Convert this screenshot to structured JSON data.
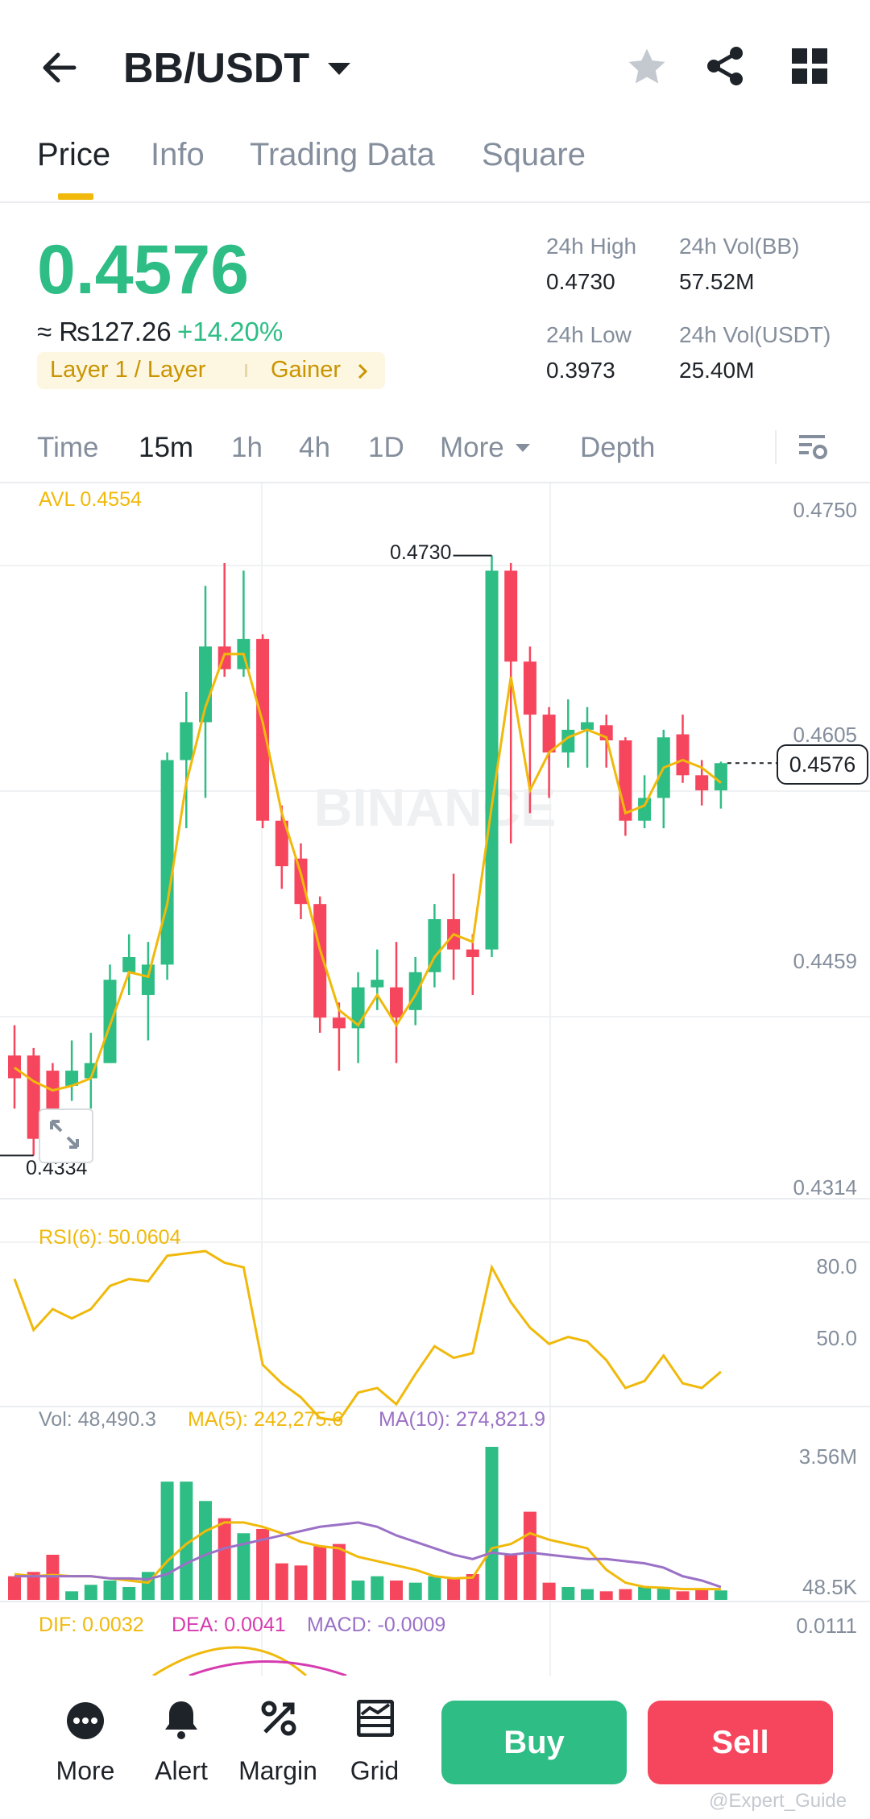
{
  "header": {
    "pair": "BB/USDT",
    "back_icon": "arrow-left-icon",
    "favorite_icon": "star-icon",
    "share_icon": "share-icon",
    "grid_icon": "grid-icon"
  },
  "tabs": [
    {
      "label": "Price",
      "active": true
    },
    {
      "label": "Info",
      "active": false
    },
    {
      "label": "Trading Data",
      "active": false
    },
    {
      "label": "Square",
      "active": false
    }
  ],
  "ticker": {
    "last_price": "0.4576",
    "fiat_value": "≈ ₨127.26",
    "change": "+14.20%",
    "tag_category": "Layer 1 / Layer",
    "tag_rank": "Gainer",
    "high_label": "24h High",
    "high_value": "0.4730",
    "low_label": "24h Low",
    "low_value": "0.3973",
    "vol_base_label": "24h Vol(BB)",
    "vol_base_value": "57.52M",
    "vol_quote_label": "24h Vol(USDT)",
    "vol_quote_value": "25.40M"
  },
  "timeframes": {
    "items": [
      "Time",
      "15m",
      "1h",
      "4h",
      "1D",
      "More"
    ],
    "active": "15m",
    "depth": "Depth"
  },
  "colors": {
    "up": "#2ebd85",
    "down": "#f6465d",
    "avl": "#f0b90b",
    "ma10": "#9a71c6",
    "dea": "#d63bb0",
    "accent": "#f0b90b"
  },
  "chart_data": [
    {
      "type": "candlestick",
      "interval": "15m",
      "watermark": "BINANCE",
      "overlay_label": "AVL 0.4554",
      "y_ticks": [
        "0.4750",
        "0.4605",
        "0.4459",
        "0.4314"
      ],
      "ylim": [
        0.4314,
        0.475
      ],
      "high_marker": "0.4730",
      "low_marker": "0.4334",
      "current_price_tag": "0.4576",
      "candles": [
        {
          "o": 0.44,
          "c": 0.4385,
          "h": 0.442,
          "l": 0.4365
        },
        {
          "o": 0.44,
          "c": 0.4345,
          "h": 0.4405,
          "l": 0.4334
        },
        {
          "o": 0.439,
          "c": 0.436,
          "h": 0.4395,
          "l": 0.4345
        },
        {
          "o": 0.438,
          "c": 0.439,
          "h": 0.441,
          "l": 0.437
        },
        {
          "o": 0.4385,
          "c": 0.4395,
          "h": 0.4415,
          "l": 0.4365
        },
        {
          "o": 0.4395,
          "c": 0.445,
          "h": 0.446,
          "l": 0.4395
        },
        {
          "o": 0.4455,
          "c": 0.4465,
          "h": 0.448,
          "l": 0.444
        },
        {
          "o": 0.444,
          "c": 0.446,
          "h": 0.4475,
          "l": 0.441
        },
        {
          "o": 0.446,
          "c": 0.4595,
          "h": 0.46,
          "l": 0.445
        },
        {
          "o": 0.4595,
          "c": 0.462,
          "h": 0.464,
          "l": 0.455
        },
        {
          "o": 0.462,
          "c": 0.467,
          "h": 0.471,
          "l": 0.457
        },
        {
          "o": 0.467,
          "c": 0.4655,
          "h": 0.4725,
          "l": 0.465
        },
        {
          "o": 0.4655,
          "c": 0.4675,
          "h": 0.472,
          "l": 0.465
        },
        {
          "o": 0.4675,
          "c": 0.4555,
          "h": 0.4678,
          "l": 0.455
        },
        {
          "o": 0.4555,
          "c": 0.4525,
          "h": 0.4565,
          "l": 0.451
        },
        {
          "o": 0.453,
          "c": 0.45,
          "h": 0.454,
          "l": 0.449
        },
        {
          "o": 0.45,
          "c": 0.4425,
          "h": 0.4505,
          "l": 0.4415
        },
        {
          "o": 0.4425,
          "c": 0.4418,
          "h": 0.4435,
          "l": 0.439
        },
        {
          "o": 0.4418,
          "c": 0.4445,
          "h": 0.4455,
          "l": 0.4395
        },
        {
          "o": 0.4445,
          "c": 0.445,
          "h": 0.447,
          "l": 0.443
        },
        {
          "o": 0.4445,
          "c": 0.4425,
          "h": 0.4475,
          "l": 0.4395
        },
        {
          "o": 0.443,
          "c": 0.4455,
          "h": 0.4465,
          "l": 0.442
        },
        {
          "o": 0.4455,
          "c": 0.449,
          "h": 0.45,
          "l": 0.4445
        },
        {
          "o": 0.449,
          "c": 0.447,
          "h": 0.452,
          "l": 0.445
        },
        {
          "o": 0.447,
          "c": 0.4465,
          "h": 0.448,
          "l": 0.444
        },
        {
          "o": 0.447,
          "c": 0.472,
          "h": 0.473,
          "l": 0.4465
        },
        {
          "o": 0.472,
          "c": 0.466,
          "h": 0.4725,
          "l": 0.454
        },
        {
          "o": 0.466,
          "c": 0.4625,
          "h": 0.467,
          "l": 0.456
        },
        {
          "o": 0.4625,
          "c": 0.46,
          "h": 0.463,
          "l": 0.457
        },
        {
          "o": 0.46,
          "c": 0.4615,
          "h": 0.4635,
          "l": 0.459
        },
        {
          "o": 0.4615,
          "c": 0.462,
          "h": 0.463,
          "l": 0.459
        },
        {
          "o": 0.4618,
          "c": 0.4608,
          "h": 0.4625,
          "l": 0.459
        },
        {
          "o": 0.4608,
          "c": 0.4555,
          "h": 0.461,
          "l": 0.4545
        },
        {
          "o": 0.4555,
          "c": 0.457,
          "h": 0.4585,
          "l": 0.455
        },
        {
          "o": 0.457,
          "c": 0.461,
          "h": 0.4615,
          "l": 0.455
        },
        {
          "o": 0.4612,
          "c": 0.4585,
          "h": 0.4625,
          "l": 0.458
        },
        {
          "o": 0.4585,
          "c": 0.4575,
          "h": 0.4595,
          "l": 0.4565
        },
        {
          "o": 0.4575,
          "c": 0.4593,
          "h": 0.4594,
          "l": 0.4563
        }
      ],
      "avl": [
        0.4392,
        0.4383,
        0.4377,
        0.438,
        0.4385,
        0.442,
        0.4455,
        0.4452,
        0.45,
        0.458,
        0.463,
        0.4665,
        0.4665,
        0.462,
        0.456,
        0.452,
        0.447,
        0.443,
        0.442,
        0.444,
        0.442,
        0.444,
        0.4465,
        0.448,
        0.4475,
        0.4565,
        0.465,
        0.4575,
        0.46,
        0.461,
        0.4615,
        0.461,
        0.456,
        0.4565,
        0.459,
        0.4595,
        0.459,
        0.458
      ]
    },
    {
      "type": "line",
      "label": "RSI(6): 50.0604",
      "y_ticks": [
        "80.0",
        "50.0"
      ],
      "ylim": [
        25,
        100
      ],
      "values": [
        80,
        58,
        67,
        63,
        67,
        77,
        80,
        79,
        90,
        91,
        92,
        87,
        85,
        43,
        35,
        29,
        20,
        19,
        31,
        33,
        26,
        39,
        51,
        46,
        48,
        85,
        70,
        59,
        52,
        55,
        53,
        45,
        33,
        36,
        47,
        35,
        33,
        40
      ]
    },
    {
      "type": "bar",
      "label_vol": "Vol: 48,490.3",
      "label_ma5": "MA(5): 242,275.6",
      "label_ma10": "MA(10): 274,821.9",
      "y_ticks": [
        "3.56M",
        "48.5K"
      ],
      "ylim": [
        0,
        3.56
      ],
      "unit": "M",
      "values": [
        0.55,
        0.65,
        1.05,
        0.2,
        0.35,
        0.45,
        0.3,
        0.65,
        2.75,
        2.75,
        2.3,
        1.9,
        1.55,
        1.65,
        0.85,
        0.8,
        1.25,
        1.3,
        0.45,
        0.55,
        0.45,
        0.4,
        0.55,
        0.5,
        0.6,
        3.56,
        1.05,
        2.05,
        0.4,
        0.3,
        0.25,
        0.2,
        0.25,
        0.3,
        0.3,
        0.2,
        0.25,
        0.22
      ],
      "ma5": [
        0.6,
        0.55,
        0.58,
        0.55,
        0.55,
        0.5,
        0.45,
        0.4,
        0.9,
        1.3,
        1.6,
        1.8,
        1.8,
        1.7,
        1.55,
        1.35,
        1.25,
        1.2,
        1.0,
        0.9,
        0.8,
        0.7,
        0.55,
        0.5,
        0.52,
        1.2,
        1.3,
        1.55,
        1.4,
        1.3,
        1.2,
        0.7,
        0.4,
        0.3,
        0.28,
        0.25,
        0.25,
        0.25
      ],
      "ma10": [
        0.55,
        0.55,
        0.55,
        0.55,
        0.55,
        0.5,
        0.5,
        0.48,
        0.6,
        0.85,
        1.05,
        1.2,
        1.3,
        1.4,
        1.5,
        1.6,
        1.7,
        1.75,
        1.8,
        1.7,
        1.5,
        1.35,
        1.2,
        1.05,
        0.95,
        1.1,
        1.05,
        1.1,
        1.05,
        1.0,
        0.95,
        0.95,
        0.9,
        0.85,
        0.75,
        0.55,
        0.45,
        0.3
      ]
    },
    {
      "type": "line",
      "label_dif": "DIF: 0.0032",
      "label_dea": "DEA: 0.0041",
      "label_macd": "MACD: -0.0009",
      "y_ticks": [
        "0.0111"
      ]
    }
  ],
  "bottom_nav": [
    {
      "label": "More",
      "icon": "more-dots-icon"
    },
    {
      "label": "Alert",
      "icon": "bell-icon"
    },
    {
      "label": "Margin",
      "icon": "percent-icon"
    },
    {
      "label": "Grid",
      "icon": "grid-bot-icon"
    }
  ],
  "actions": {
    "buy": "Buy",
    "sell": "Sell"
  },
  "watermark_credit": "@Expert_Guide"
}
